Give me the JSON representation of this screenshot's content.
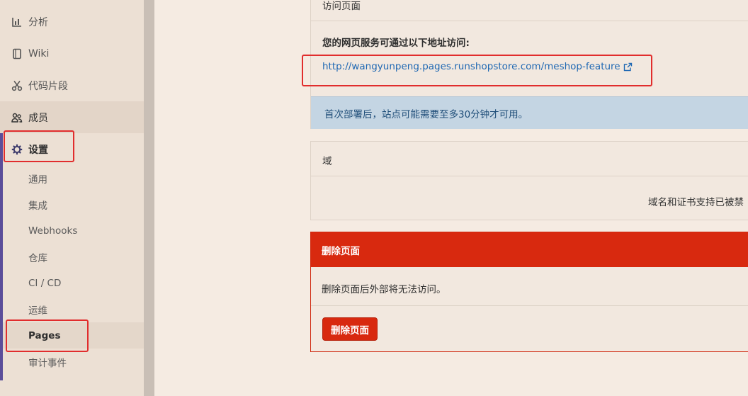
{
  "sidebar": {
    "items": [
      {
        "label": "分析",
        "icon": "chart-bar-icon"
      },
      {
        "label": "Wiki",
        "icon": "book-icon"
      },
      {
        "label": "代码片段",
        "icon": "scissors-icon"
      },
      {
        "label": "成员",
        "icon": "users-icon"
      },
      {
        "label": "设置",
        "icon": "gear-icon"
      }
    ],
    "settings_subitems": [
      {
        "label": "通用"
      },
      {
        "label": "集成"
      },
      {
        "label": "Webhooks"
      },
      {
        "label": "仓库"
      },
      {
        "label": "CI / CD"
      },
      {
        "label": "运维"
      },
      {
        "label": "Pages"
      },
      {
        "label": "审计事件"
      }
    ]
  },
  "access": {
    "header": "访问页面",
    "title": "您的网页服务可通过以下地址访问:",
    "url": "http://wangyunpeng.pages.runshopstore.com/meshop-feature",
    "info": "首次部署后，站点可能需要至多30分钟才可用。"
  },
  "domains": {
    "header": "域",
    "note": "域名和证书支持已被禁"
  },
  "danger": {
    "header": "删除页面",
    "text": "删除页面后外部将无法访问。",
    "button": "删除页面"
  },
  "colors": {
    "danger": "#d8290f",
    "link": "#1f68b3",
    "info_bg": "#c4d5e3",
    "accent": "#5b4e9a",
    "highlight_box": "#e12d2d"
  }
}
